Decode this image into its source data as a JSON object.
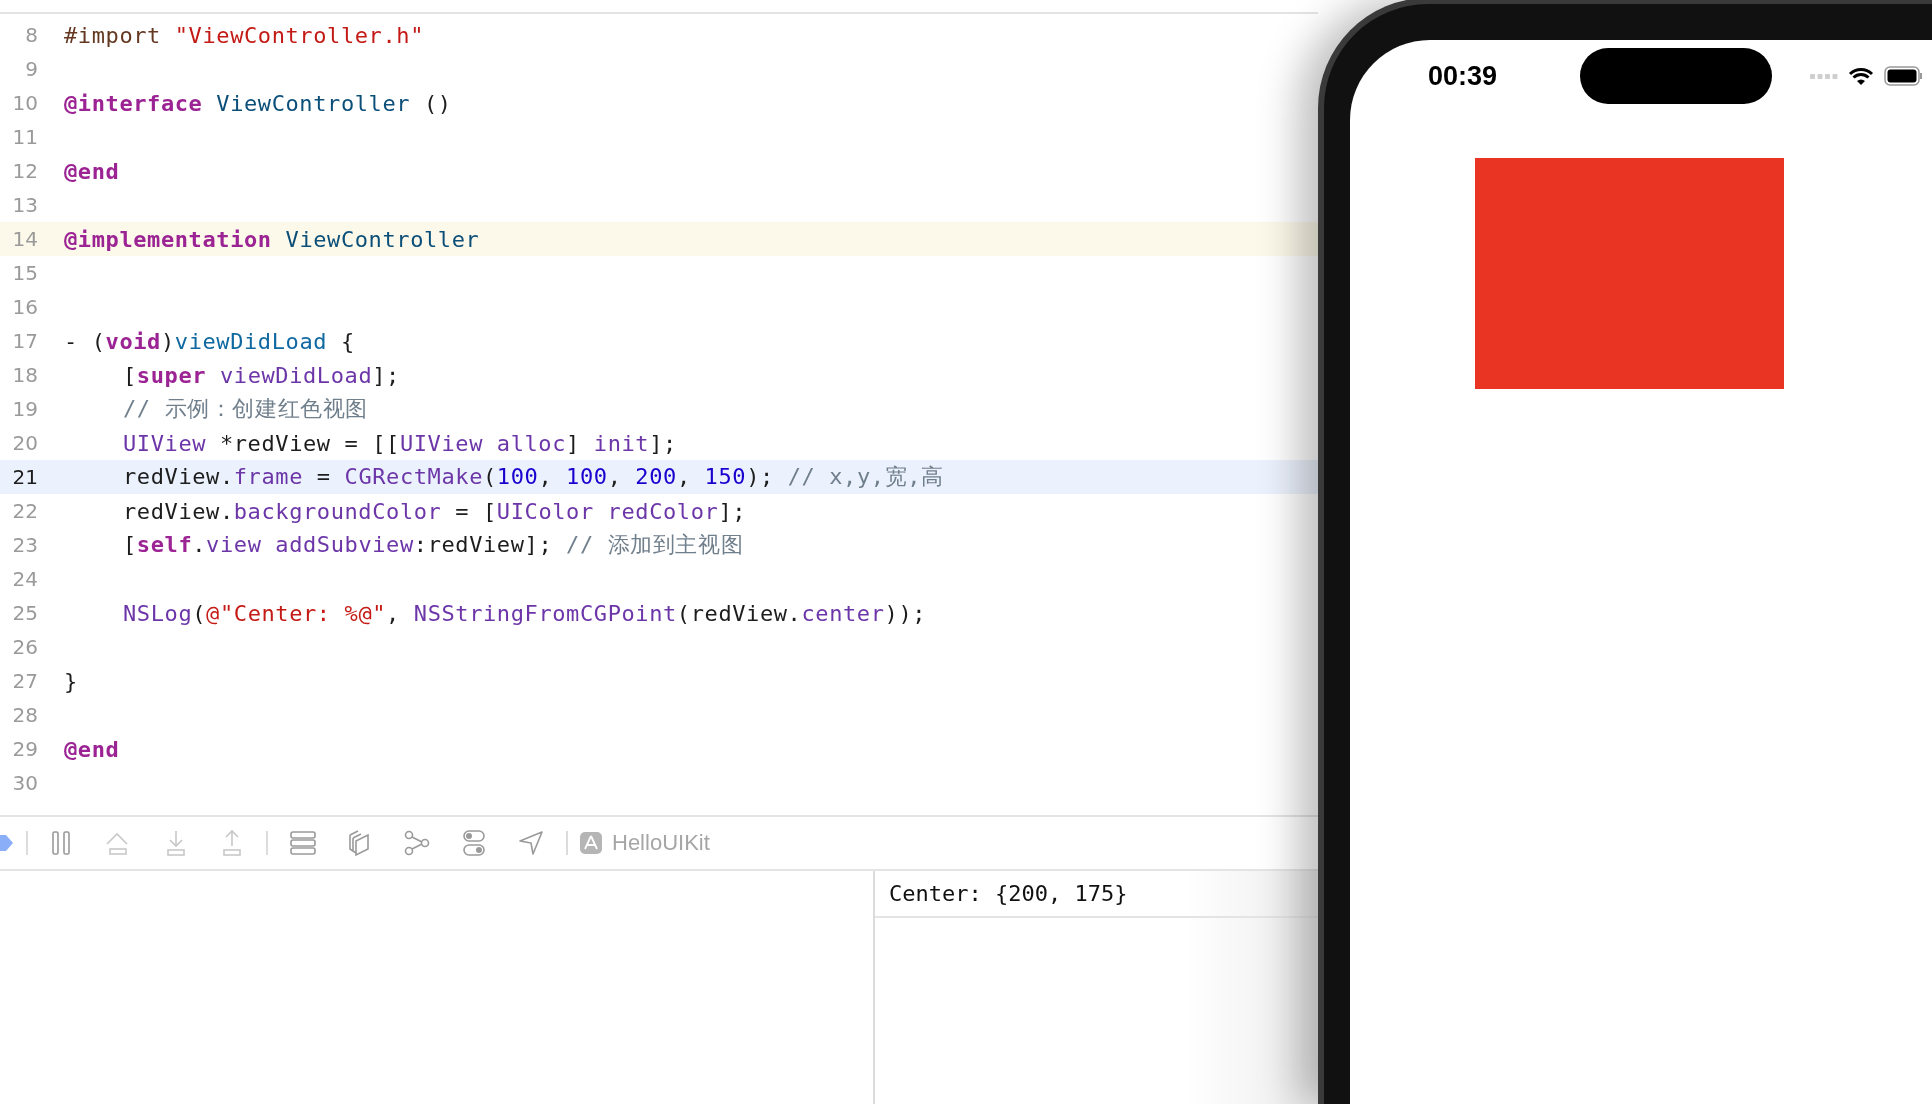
{
  "editor": {
    "lines": [
      {
        "number": "8",
        "selected": false,
        "marked": false,
        "indented": false,
        "tokens": [
          {
            "t": "#import ",
            "kind": "pre"
          },
          {
            "t": "\"ViewController.h\"",
            "kind": "str"
          }
        ]
      },
      {
        "number": "9",
        "selected": false,
        "marked": false
      },
      {
        "number": "10",
        "selected": false,
        "marked": false,
        "indented": false,
        "tokens": [
          {
            "t": "@interface ",
            "kind": "kw"
          },
          {
            "t": "ViewController",
            "kind": "cls"
          },
          {
            "t": " ()",
            "kind": "plain"
          }
        ]
      },
      {
        "number": "11",
        "selected": false,
        "marked": false
      },
      {
        "number": "12",
        "selected": false,
        "marked": false,
        "indented": false,
        "tokens": [
          {
            "t": "@end",
            "kind": "kw"
          }
        ]
      },
      {
        "number": "13",
        "selected": false,
        "marked": false
      },
      {
        "number": "14",
        "selected": false,
        "marked": true,
        "indented": false,
        "tokens": [
          {
            "t": "@implementation ",
            "kind": "kw"
          },
          {
            "t": "ViewController",
            "kind": "cls"
          }
        ]
      },
      {
        "number": "15",
        "selected": false,
        "marked": false
      },
      {
        "number": "16",
        "selected": false,
        "marked": false
      },
      {
        "number": "17",
        "selected": false,
        "marked": false,
        "indented": false,
        "tokens": [
          {
            "t": "- (",
            "kind": "plain"
          },
          {
            "t": "void",
            "kind": "kw"
          },
          {
            "t": ")",
            "kind": "plain"
          },
          {
            "t": "viewDidLoad",
            "kind": "fn"
          },
          {
            "t": " {",
            "kind": "plain"
          }
        ]
      },
      {
        "number": "18",
        "selected": false,
        "marked": false,
        "indented": true,
        "tokens": [
          {
            "t": "[",
            "kind": "plain"
          },
          {
            "t": "super ",
            "kind": "kw"
          },
          {
            "t": "viewDidLoad",
            "kind": "sys"
          },
          {
            "t": "];",
            "kind": "plain"
          }
        ]
      },
      {
        "number": "19",
        "selected": false,
        "marked": false,
        "indented": true,
        "tokens": [
          {
            "t": "// 示例：创建红色视图",
            "kind": "com"
          }
        ]
      },
      {
        "number": "20",
        "selected": false,
        "marked": false,
        "indented": true,
        "tokens": [
          {
            "t": "UIView",
            "kind": "sys"
          },
          {
            "t": " *redView = [[",
            "kind": "plain"
          },
          {
            "t": "UIView alloc",
            "kind": "sys"
          },
          {
            "t": "] ",
            "kind": "plain"
          },
          {
            "t": "init",
            "kind": "sys"
          },
          {
            "t": "];",
            "kind": "plain"
          }
        ]
      },
      {
        "number": "21",
        "selected": true,
        "marked": false,
        "indented": true,
        "tokens": [
          {
            "t": "redView.",
            "kind": "plain"
          },
          {
            "t": "frame",
            "kind": "sys"
          },
          {
            "t": " = ",
            "kind": "plain"
          },
          {
            "t": "CGRectMake",
            "kind": "sys"
          },
          {
            "t": "(",
            "kind": "plain"
          },
          {
            "t": "100",
            "kind": "num"
          },
          {
            "t": ", ",
            "kind": "plain"
          },
          {
            "t": "100",
            "kind": "num"
          },
          {
            "t": ", ",
            "kind": "plain"
          },
          {
            "t": "200",
            "kind": "num"
          },
          {
            "t": ", ",
            "kind": "plain"
          },
          {
            "t": "150",
            "kind": "num"
          },
          {
            "t": "); ",
            "kind": "plain"
          },
          {
            "t": "// x,y,宽,高",
            "kind": "com"
          }
        ]
      },
      {
        "number": "22",
        "selected": false,
        "marked": false,
        "indented": true,
        "tokens": [
          {
            "t": "redView.",
            "kind": "plain"
          },
          {
            "t": "backgroundColor",
            "kind": "sys"
          },
          {
            "t": " = [",
            "kind": "plain"
          },
          {
            "t": "UIColor redColor",
            "kind": "sys"
          },
          {
            "t": "];",
            "kind": "plain"
          }
        ]
      },
      {
        "number": "23",
        "selected": false,
        "marked": false,
        "indented": true,
        "tokens": [
          {
            "t": "[",
            "kind": "plain"
          },
          {
            "t": "self",
            "kind": "kw"
          },
          {
            "t": ".",
            "kind": "plain"
          },
          {
            "t": "view addSubview",
            "kind": "sys"
          },
          {
            "t": ":redView]; ",
            "kind": "plain"
          },
          {
            "t": "// 添加到主视图",
            "kind": "com"
          }
        ]
      },
      {
        "number": "24",
        "selected": false,
        "marked": false
      },
      {
        "number": "25",
        "selected": false,
        "marked": false,
        "indented": true,
        "tokens": [
          {
            "t": "NSLog",
            "kind": "sys"
          },
          {
            "t": "(",
            "kind": "plain"
          },
          {
            "t": "@\"Center: %@\"",
            "kind": "str"
          },
          {
            "t": ", ",
            "kind": "plain"
          },
          {
            "t": "NSStringFromCGPoint",
            "kind": "sys"
          },
          {
            "t": "(redView.",
            "kind": "plain"
          },
          {
            "t": "center",
            "kind": "sys"
          },
          {
            "t": "));",
            "kind": "plain"
          }
        ]
      },
      {
        "number": "26",
        "selected": false,
        "marked": false
      },
      {
        "number": "27",
        "selected": false,
        "marked": false,
        "indented": false,
        "tokens": [
          {
            "t": "}",
            "kind": "plain"
          }
        ]
      },
      {
        "number": "28",
        "selected": false,
        "marked": false
      },
      {
        "number": "29",
        "selected": false,
        "marked": false,
        "indented": false,
        "tokens": [
          {
            "t": "@end",
            "kind": "kw"
          }
        ]
      },
      {
        "number": "30",
        "selected": false,
        "marked": false
      }
    ]
  },
  "debug_bar": {
    "scheme": {
      "label": "HelloUIKit",
      "disabled": true
    }
  },
  "console": {
    "output": "Center: {200, 175}"
  },
  "simulator": {
    "time": "00:39"
  }
}
